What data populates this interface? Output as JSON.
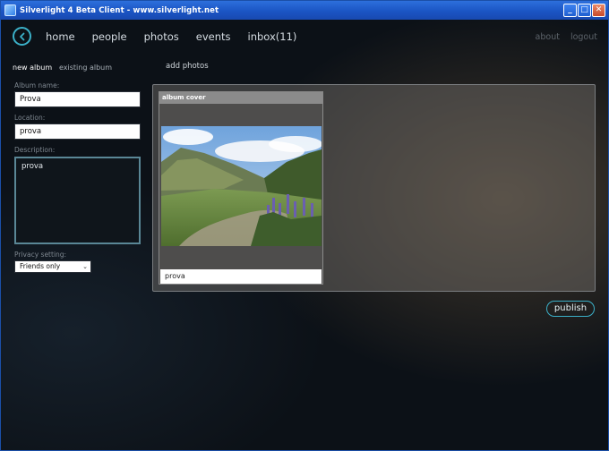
{
  "window": {
    "title": "Silverlight 4 Beta Client - www.silverlight.net",
    "minimize": "_",
    "maximize": "□",
    "close": "✕"
  },
  "nav": {
    "items": [
      {
        "label": "home"
      },
      {
        "label": "people"
      },
      {
        "label": "photos"
      },
      {
        "label": "events"
      },
      {
        "label": "inbox(11)"
      }
    ],
    "right": {
      "about": "about",
      "logout": "logout"
    }
  },
  "tabs": {
    "new_album": "new album",
    "existing_album": "existing album"
  },
  "add_photos": "add photos",
  "form": {
    "album_name_label": "Album name:",
    "album_name_value": "Prova",
    "location_label": "Location:",
    "location_value": "prova",
    "description_label": "Description:",
    "description_value": "prova",
    "privacy_label": "Privacy setting:",
    "privacy_value": "Friends only"
  },
  "album_cover": {
    "header": "album cover",
    "caption": "prova"
  },
  "publish_label": "publish",
  "icons": {
    "back": "back-arrow-icon",
    "dropdown": "chevron-down-icon"
  },
  "colors": {
    "accent": "#3bb0c8",
    "titlebar": "#1b55c4"
  }
}
